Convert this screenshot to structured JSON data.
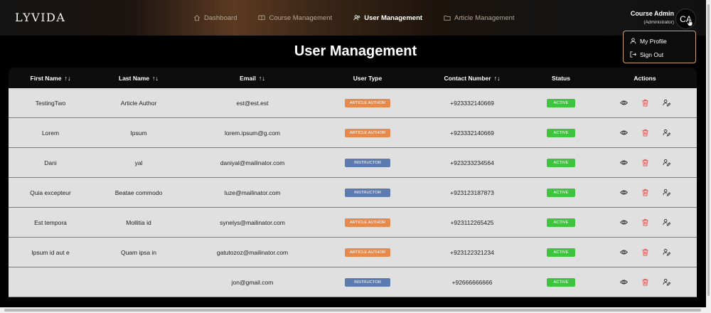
{
  "app": {
    "logo": "LYVIDA"
  },
  "nav": {
    "items": [
      {
        "label": "Dashboard",
        "icon": "home-icon",
        "active": false
      },
      {
        "label": "Course Management",
        "icon": "book-icon",
        "active": false
      },
      {
        "label": "User Management",
        "icon": "users-gear-icon",
        "active": true
      },
      {
        "label": "Article Management",
        "icon": "folder-icon",
        "active": false
      }
    ]
  },
  "user": {
    "name": "Course Admin",
    "role": "(Administrator)",
    "initials": "CA"
  },
  "dropdown": {
    "profile": "My Profile",
    "signout": "Sign Out"
  },
  "page": {
    "title": "User Management"
  },
  "table": {
    "headers": {
      "first_name": "First Name",
      "last_name": "Last Name",
      "email": "Email",
      "user_type": "User Type",
      "contact": "Contact Number",
      "status": "Status",
      "actions": "Actions",
      "sort_glyph": "↑↓"
    },
    "rows": [
      {
        "first": "TestingTwo",
        "last": "Article Author",
        "email": "est@est.est",
        "type": "Article Author",
        "type_kind": "author",
        "contact": "+923332140669",
        "status": "Active"
      },
      {
        "first": "Lorem",
        "last": "Ipsum",
        "email": "lorem.ipsum@g.com",
        "type": "Article Author",
        "type_kind": "author",
        "contact": "+923332140669",
        "status": "Active"
      },
      {
        "first": "Dani",
        "last": "yal",
        "email": "daniyal@mailinator.com",
        "type": "Instructor",
        "type_kind": "instructor",
        "contact": "+923233234564",
        "status": "Active"
      },
      {
        "first": "Quia excepteur",
        "last": "Beatae commodo",
        "email": "luze@mailinator.com",
        "type": "Instructor",
        "type_kind": "instructor",
        "contact": "+923123187873",
        "status": "Active"
      },
      {
        "first": "Est tempora",
        "last": "Mollitia id",
        "email": "synelys@mailinator.com",
        "type": "Article Author",
        "type_kind": "author",
        "contact": "+923112265425",
        "status": "Active"
      },
      {
        "first": "Ipsum id aut e",
        "last": "Quam ipsa in",
        "email": "gatutozoz@mailinator.com",
        "type": "Article Author",
        "type_kind": "author",
        "contact": "+923122321234",
        "status": "Active"
      },
      {
        "first": "",
        "last": "",
        "email": "jon@gmail.com",
        "type": "Instructor",
        "type_kind": "instructor",
        "contact": "+92666666666",
        "status": "Active"
      }
    ]
  },
  "colors": {
    "author_badge": "#e58a4c",
    "instructor_badge": "#5b7bb0",
    "active_status": "#3ec43e",
    "delete_icon": "#d9534f",
    "dropdown_border": "#c9a272"
  }
}
